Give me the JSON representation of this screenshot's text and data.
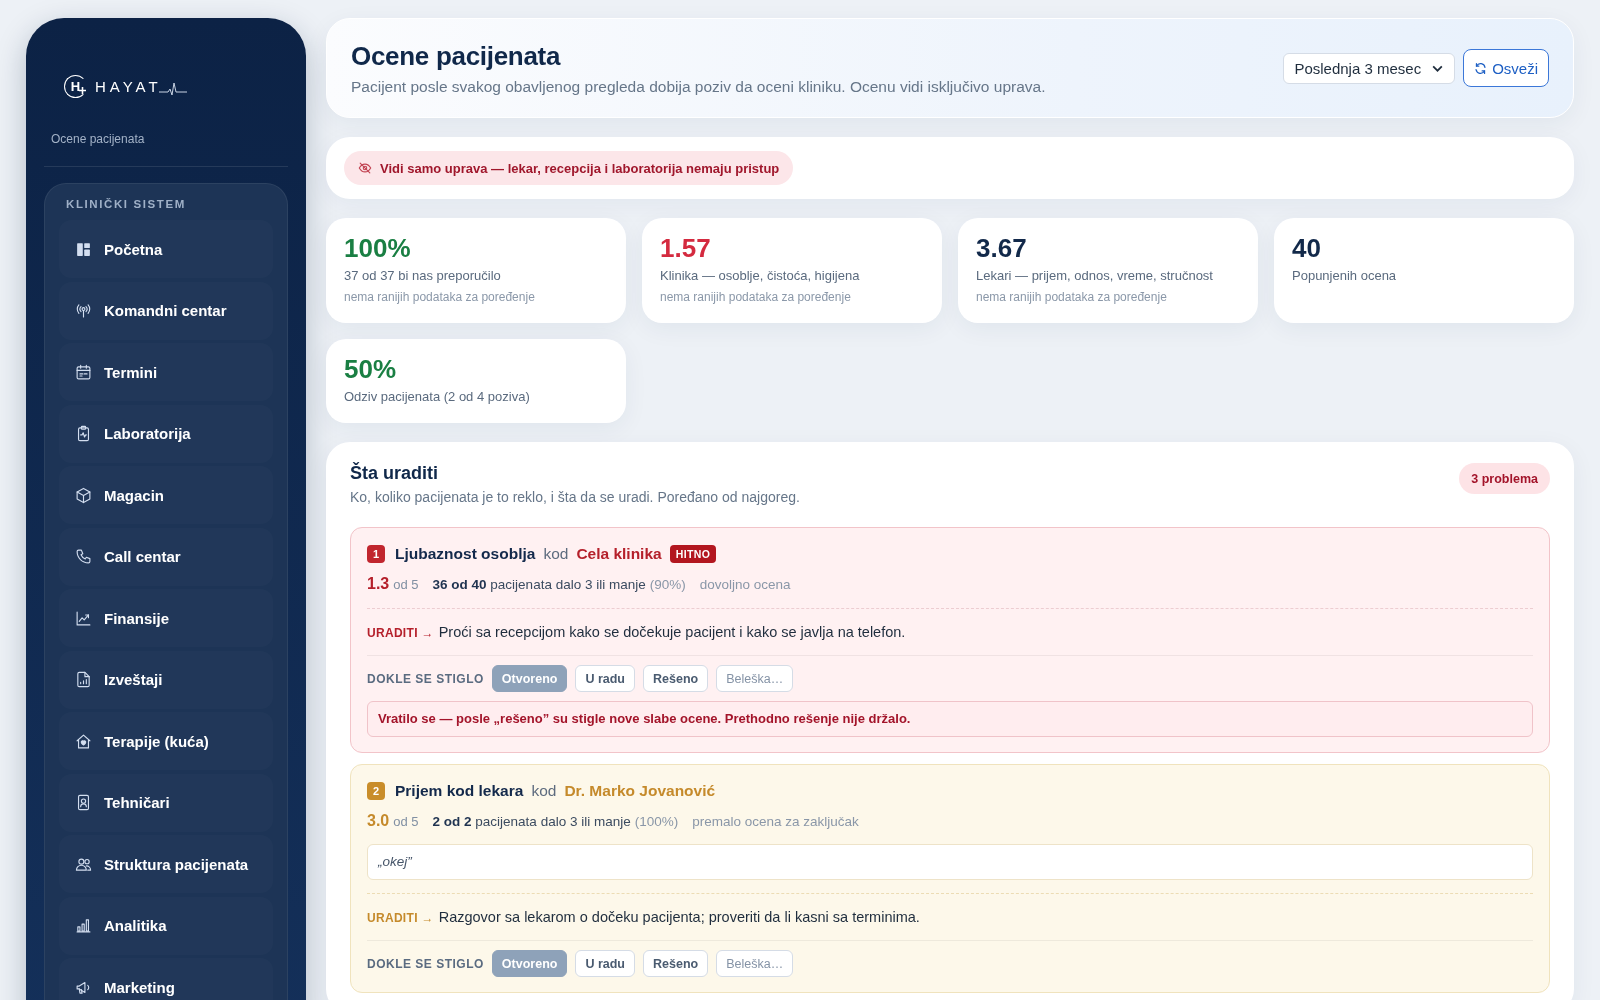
{
  "sidebar": {
    "logo": {
      "mark": "H",
      "name": "HAYAT"
    },
    "page_label": "Ocene pacijenata",
    "section_title": "KLINIČKI SISTEM",
    "items": [
      {
        "label": "Početna",
        "selected": false
      },
      {
        "label": "Komandni centar",
        "selected": false
      },
      {
        "label": "Termini",
        "selected": false
      },
      {
        "label": "Laboratorija",
        "selected": false
      },
      {
        "label": "Magacin",
        "selected": false
      },
      {
        "label": "Call centar",
        "selected": false
      },
      {
        "label": "Finansije",
        "selected": false
      },
      {
        "label": "Izveštaji",
        "selected": false
      },
      {
        "label": "Terapije (kuća)",
        "selected": false
      },
      {
        "label": "Tehničari",
        "selected": false
      },
      {
        "label": "Struktura pacijenata",
        "selected": false
      },
      {
        "label": "Analitika",
        "selected": false
      },
      {
        "label": "Marketing",
        "selected": false
      }
    ]
  },
  "header": {
    "title": "Ocene pacijenata",
    "subtitle": "Pacijent posle svakog obavljenog pregleda dobija poziv da oceni kliniku. Ocenu vidi isključivo uprava.",
    "period_select": {
      "value": "Poslednja 3 mesec"
    },
    "refresh_button": "Osveži"
  },
  "notice": {
    "text": "Vidi samo uprava — lekar, recepcija i laboratorija nemaju pristup"
  },
  "stats": [
    {
      "value": "100%",
      "color": "#1a7f43",
      "label": "37 od 37 bi nas preporučilo",
      "note": "nema ranijih podataka za poređenje"
    },
    {
      "value": "1.57",
      "color": "#d42a3f",
      "label": "Klinika — osoblje, čistoća, higijena",
      "note": "nema ranijih podataka za poređenje"
    },
    {
      "value": "3.67",
      "color": "#12294a",
      "label": "Lekari — prijem, odnos, vreme, stručnost",
      "note": "nema ranijih podataka za poređenje"
    },
    {
      "value": "40",
      "color": "#12294a",
      "label": "Popunjenih ocena"
    },
    {
      "value": "50%",
      "color": "#1a7f43",
      "label": "Odziv pacijenata (2 od 4 poziva)"
    }
  ],
  "actions": {
    "title": "Šta uraditi",
    "subtitle": "Ko, koliko pacijenata je to reklo, i šta da se uradi. Poređano od najgoreg.",
    "count_badge": "3 problema",
    "issues": [
      {
        "kind": "urgent",
        "number": "1",
        "title": "Ljubaznost osoblja",
        "connector": "kod",
        "target": "Cela klinika",
        "tag": "HITNO",
        "score": "1.3",
        "scale": "od 5",
        "summary": "**36 od 40** pacijenata dalo 3 ili manje",
        "share": "(90%)",
        "confidence": "dovoljno ocena",
        "action_label": "URADITI →",
        "action": "Proći sa recepcijom kako se dočekuje pacijent i kako se javlja na telefon.",
        "progress_label": "DOKLE SE STIGLO",
        "statuses": [
          {
            "label": "Otvoreno",
            "selected": true
          },
          {
            "label": "U radu",
            "selected": false
          },
          {
            "label": "Rešeno",
            "selected": false
          }
        ],
        "note_button": "Beleška…",
        "alert": "Vratilo se — posle „rešeno” su stigle nove slabe ocene. Prethodno rešenje nije držalo."
      },
      {
        "kind": "warning",
        "number": "2",
        "title": "Prijem kod lekara",
        "connector": "kod",
        "target": "Dr. Marko Jovanović",
        "score": "3.0",
        "scale": "od 5",
        "summary": "**2 od 2** pacijenata dalo 3 ili manje",
        "share": "(100%)",
        "confidence": "premalo ocena za zaključak",
        "quote": "„okej”",
        "action_label": "URADITI →",
        "action": "Razgovor sa lekarom o dočeku pacijenta; proveriti da li kasni sa terminima.",
        "progress_label": "DOKLE SE STIGLO",
        "statuses": [
          {
            "label": "Otvoreno",
            "selected": true
          },
          {
            "label": "U radu",
            "selected": false
          },
          {
            "label": "Rešeno",
            "selected": false
          }
        ],
        "note_button": "Beleška…"
      }
    ]
  }
}
